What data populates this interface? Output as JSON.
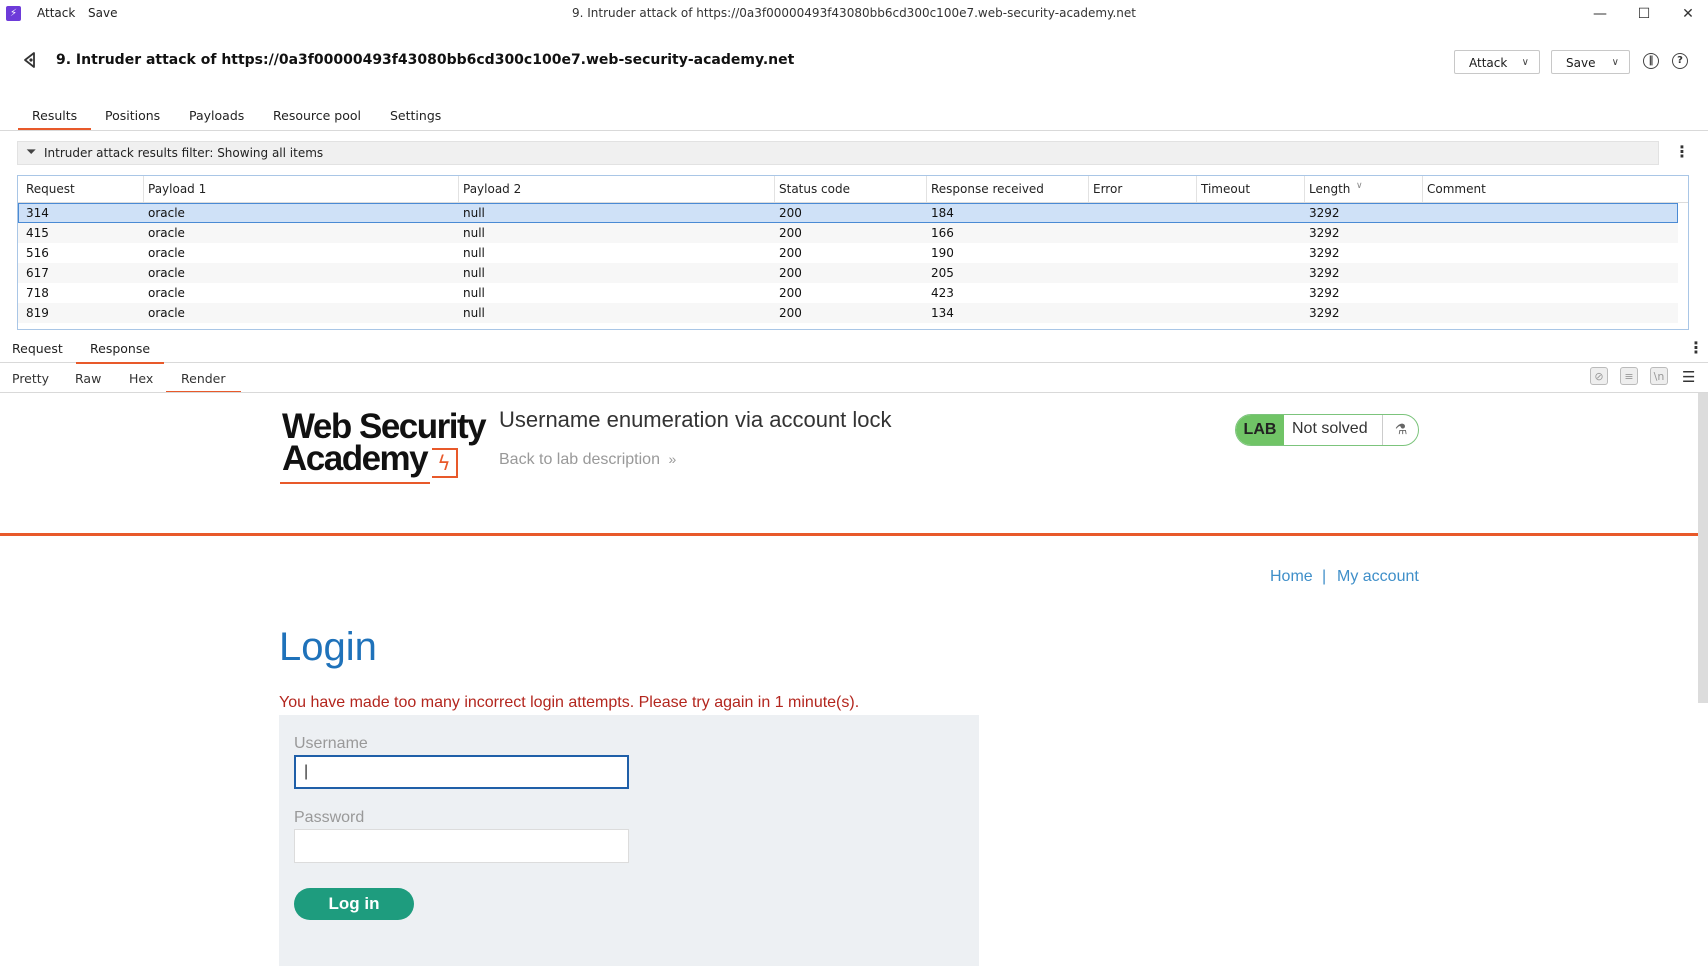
{
  "titlebar": {
    "menu": [
      "Attack",
      "Save"
    ],
    "window_title": "9. Intruder attack of https://0a3f00000493f43080bb6cd300c100e7.web-security-academy.net"
  },
  "header": {
    "title": "9. Intruder attack of https://0a3f00000493f43080bb6cd300c100e7.web-security-academy.net",
    "attack_button": "Attack",
    "save_button": "Save"
  },
  "tabs": [
    "Results",
    "Positions",
    "Payloads",
    "Resource pool",
    "Settings"
  ],
  "filter": {
    "text": "Intruder attack results filter: Showing all items"
  },
  "table": {
    "columns": [
      "Request",
      "Payload 1",
      "Payload 2",
      "Status code",
      "Response received",
      "Error",
      "Timeout",
      "Length",
      "Comment"
    ],
    "rows": [
      [
        "314",
        "oracle",
        "null",
        "200",
        "184",
        "",
        "",
        "3292",
        ""
      ],
      [
        "415",
        "oracle",
        "null",
        "200",
        "166",
        "",
        "",
        "3292",
        ""
      ],
      [
        "516",
        "oracle",
        "null",
        "200",
        "190",
        "",
        "",
        "3292",
        ""
      ],
      [
        "617",
        "oracle",
        "null",
        "200",
        "205",
        "",
        "",
        "3292",
        ""
      ],
      [
        "718",
        "oracle",
        "null",
        "200",
        "423",
        "",
        "",
        "3292",
        ""
      ],
      [
        "819",
        "oracle",
        "null",
        "200",
        "134",
        "",
        "",
        "3292",
        ""
      ]
    ],
    "sorted_column": "Length"
  },
  "rr_tabs": [
    "Request",
    "Response"
  ],
  "view_tabs": [
    "Pretty",
    "Raw",
    "Hex",
    "Render"
  ],
  "render": {
    "logo_line1": "Web Security",
    "logo_line2": "Academy",
    "lab_title": "Username enumeration via account lock",
    "back_link": "Back to lab description",
    "lab_badge": "LAB",
    "lab_status": "Not solved",
    "nav_home": "Home",
    "nav_sep": "|",
    "nav_account": "My account",
    "heading": "Login",
    "error": "You have made too many incorrect login attempts. Please try again in 1 minute(s).",
    "username_label": "Username",
    "password_label": "Password",
    "login_button": "Log in"
  },
  "colors": {
    "accent": "#e8592a",
    "link": "#3f8fc9",
    "heading": "#1f72ba",
    "error": "#b3261e",
    "button": "#1e9c7e",
    "lab_green": "#70c466"
  }
}
